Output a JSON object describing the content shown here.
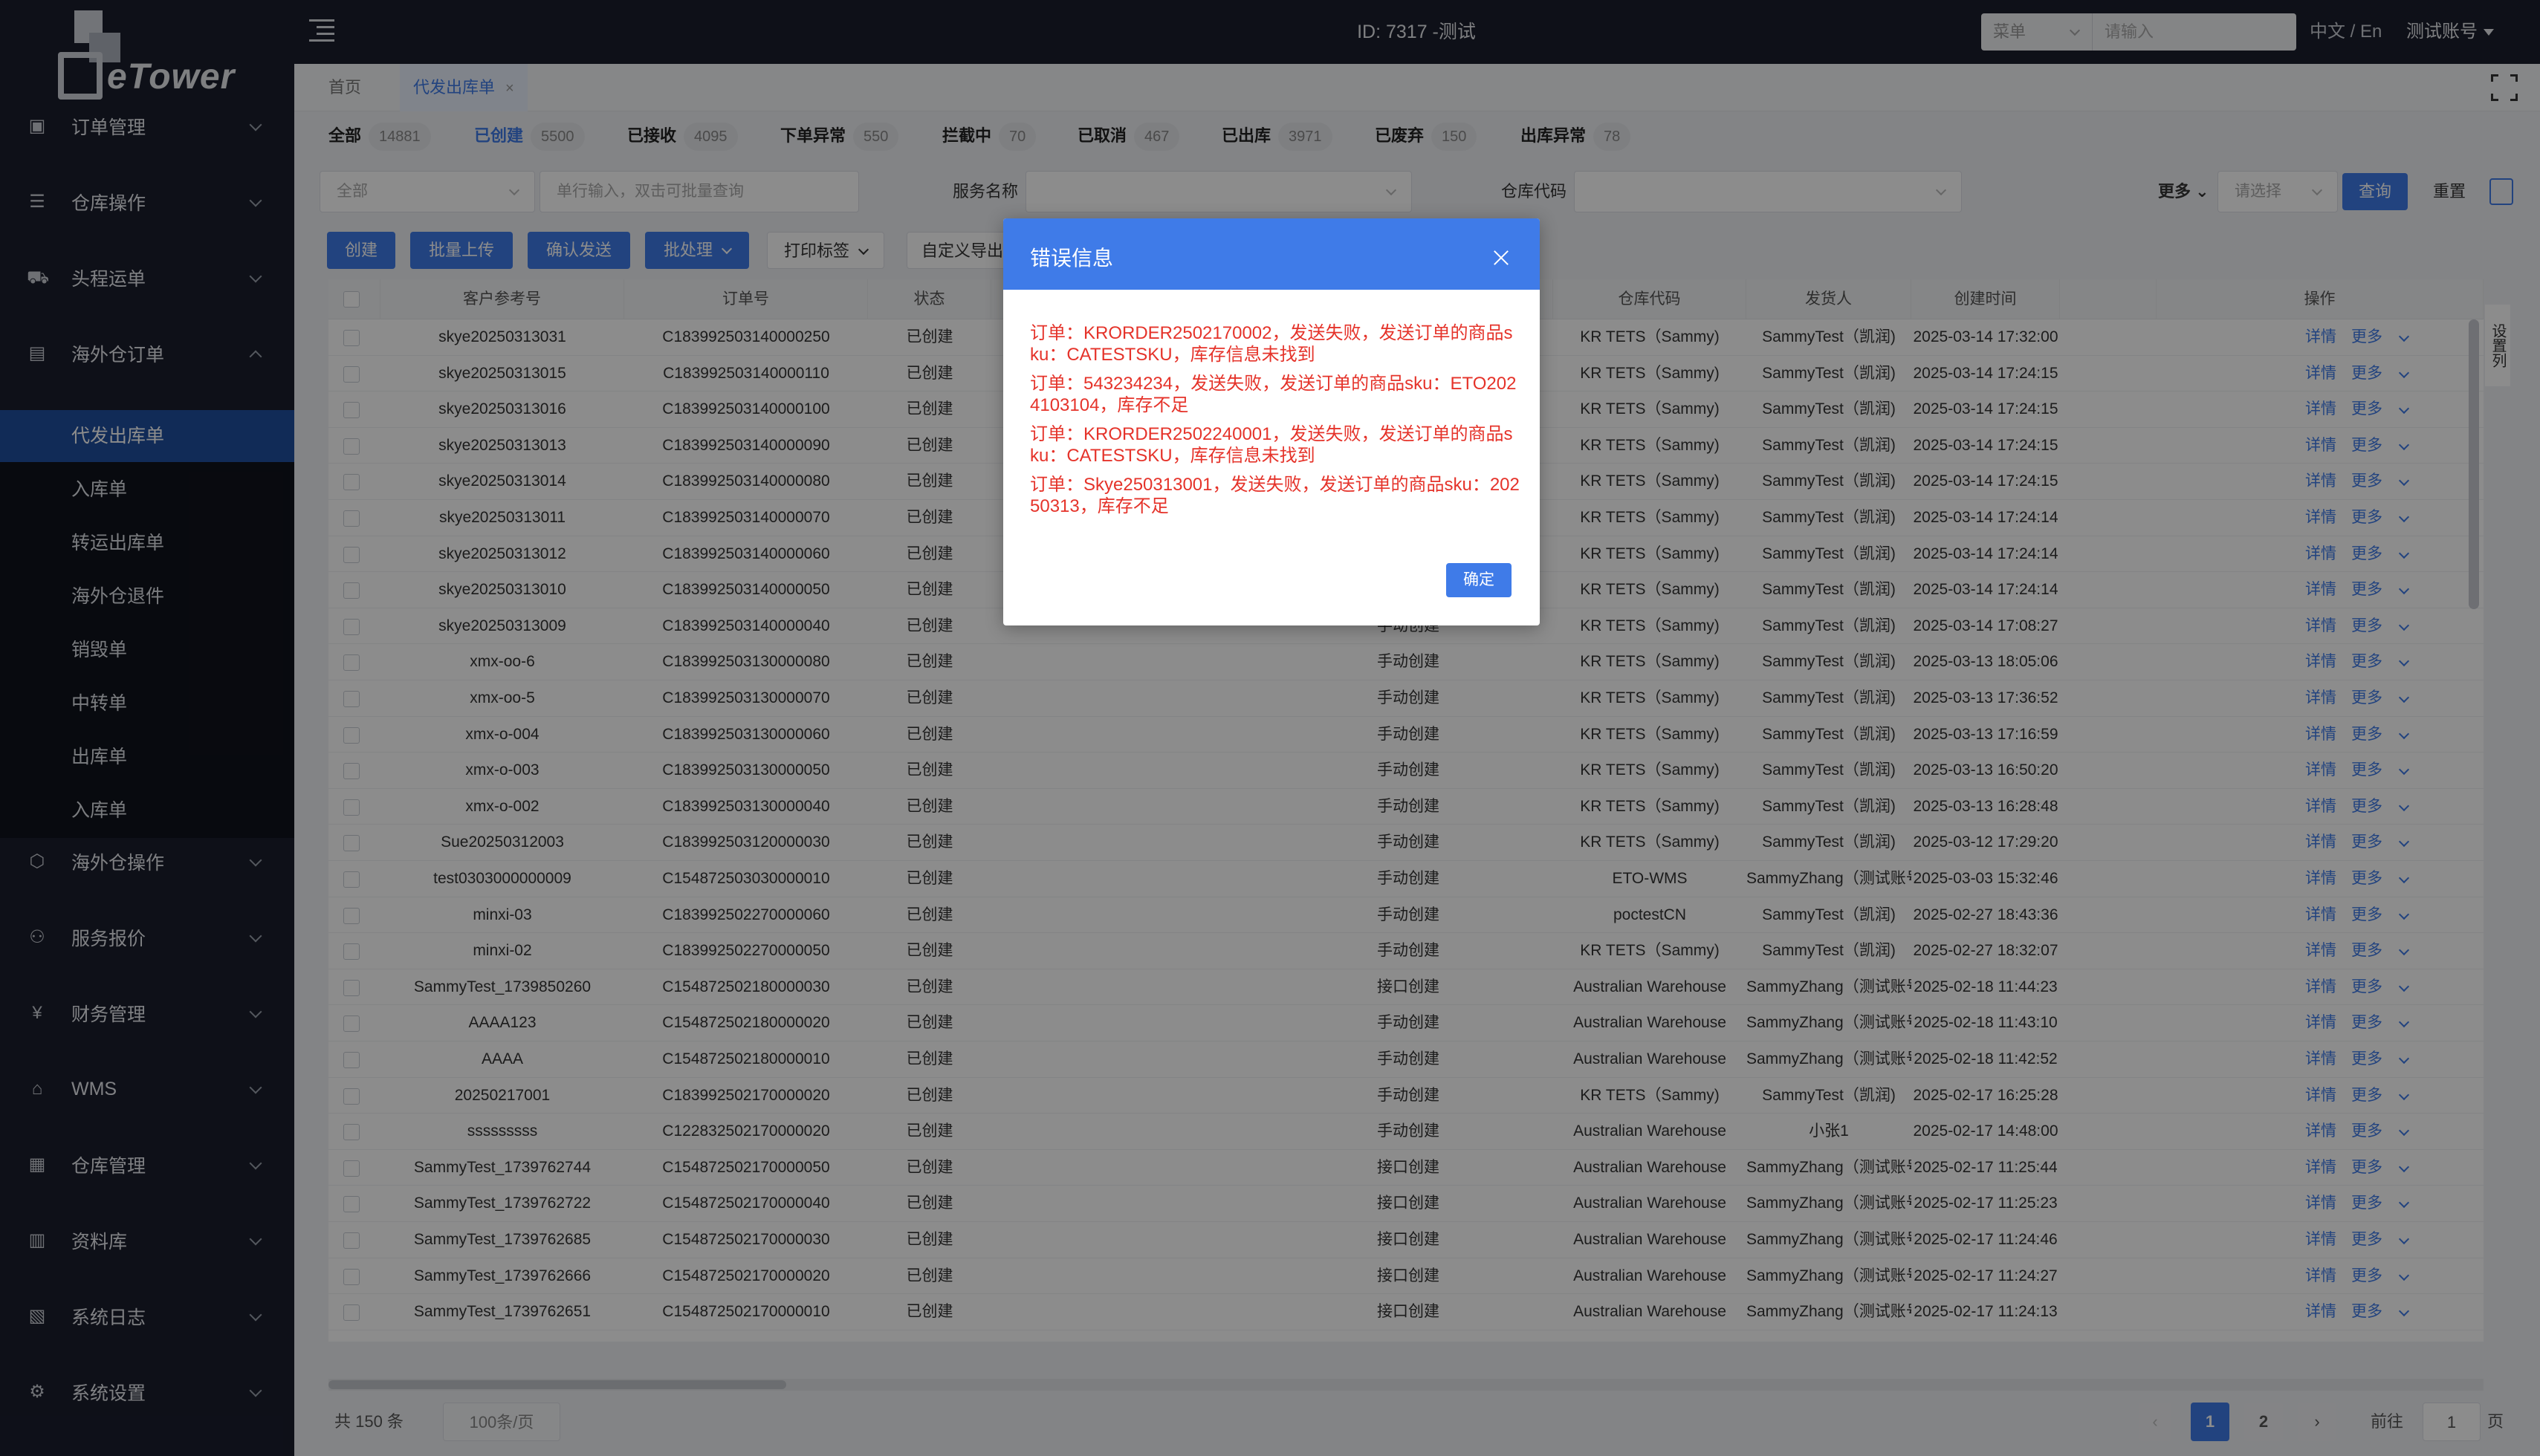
{
  "app": {
    "logo_text": "eTower",
    "top_title": "ID: 7317 -测试",
    "search_select": "菜单",
    "search_placeholder": "请输入",
    "lang": "中文 / En",
    "account": "测试账号"
  },
  "sidebar": {
    "groups": [
      {
        "label": "订单管理",
        "icon": "order-icon",
        "expanded": false
      },
      {
        "label": "仓库操作",
        "icon": "warehouse-op-icon",
        "expanded": false
      },
      {
        "label": "头程运单",
        "icon": "shipping-icon",
        "expanded": false
      },
      {
        "label": "海外仓订单",
        "icon": "document-icon",
        "expanded": true
      },
      {
        "label": "海外仓操作",
        "icon": "box-icon",
        "expanded": false
      },
      {
        "label": "服务报价",
        "icon": "share-icon",
        "expanded": false
      },
      {
        "label": "财务管理",
        "icon": "yen-icon",
        "expanded": false
      },
      {
        "label": "WMS",
        "icon": "home-icon",
        "expanded": false
      },
      {
        "label": "仓库管理",
        "icon": "building-icon",
        "expanded": false
      },
      {
        "label": "资料库",
        "icon": "grid-icon",
        "expanded": false
      },
      {
        "label": "系统日志",
        "icon": "log-icon",
        "expanded": false
      },
      {
        "label": "系统设置",
        "icon": "settings-icon",
        "expanded": false
      }
    ],
    "subitems": [
      "代发出库单",
      "入库单",
      "转运出库单",
      "海外仓退件",
      "销毁单",
      "中转单",
      "出库单",
      "入库单"
    ],
    "active_subitem": "代发出库单"
  },
  "tabs": [
    {
      "label": "首页",
      "active": false
    },
    {
      "label": "代发出库单",
      "active": true,
      "close": "×"
    }
  ],
  "status_tabs": [
    {
      "label": "全部",
      "count": "14881"
    },
    {
      "label": "已创建",
      "count": "5500",
      "active": true
    },
    {
      "label": "已接收",
      "count": "4095"
    },
    {
      "label": "下单异常",
      "count": "550"
    },
    {
      "label": "拦截中",
      "count": "70"
    },
    {
      "label": "已取消",
      "count": "467"
    },
    {
      "label": "已出库",
      "count": "3971"
    },
    {
      "label": "已废弃",
      "count": "150"
    },
    {
      "label": "出库异常",
      "count": "78"
    }
  ],
  "filters": {
    "scope": "全部",
    "query_placeholder": "单行输入，双击可批量查询",
    "service_label": "服务名称",
    "warehouse_label": "仓库代码",
    "more": "更多",
    "more_placeholder": "请选择",
    "search_btn": "查询",
    "reset_btn": "重置"
  },
  "actions": [
    {
      "label": "创建",
      "style": "primary"
    },
    {
      "label": "批量上传",
      "style": "primary"
    },
    {
      "label": "确认发送",
      "style": "primary"
    },
    {
      "label": "批处理",
      "style": "primary",
      "dropdown": true
    },
    {
      "label": "打印标签",
      "style": "plain",
      "dropdown": true
    },
    {
      "label": "自定义导出",
      "style": "plain"
    }
  ],
  "table": {
    "columns": [
      "客户参考号",
      "订单号",
      "状态",
      "",
      "",
      "仓库代码",
      "发货人",
      "创建时间",
      "",
      "操作"
    ],
    "op_detail": "详情",
    "op_more": "更多",
    "rows": [
      [
        "skye20250313031",
        "C183992503140000250",
        "已创建",
        "",
        "KR TETS（Sammy)",
        "SammyTest（凯润)",
        "2025-03-14 17:32:00"
      ],
      [
        "skye20250313015",
        "C183992503140000110",
        "已创建",
        "",
        "KR TETS（Sammy)",
        "SammyTest（凯润)",
        "2025-03-14 17:24:15"
      ],
      [
        "skye20250313016",
        "C183992503140000100",
        "已创建",
        "",
        "KR TETS（Sammy)",
        "SammyTest（凯润)",
        "2025-03-14 17:24:15"
      ],
      [
        "skye20250313013",
        "C183992503140000090",
        "已创建",
        "",
        "KR TETS（Sammy)",
        "SammyTest（凯润)",
        "2025-03-14 17:24:15"
      ],
      [
        "skye20250313014",
        "C183992503140000080",
        "已创建",
        "",
        "KR TETS（Sammy)",
        "SammyTest（凯润)",
        "2025-03-14 17:24:15"
      ],
      [
        "skye20250313011",
        "C183992503140000070",
        "已创建",
        "",
        "KR TETS（Sammy)",
        "SammyTest（凯润)",
        "2025-03-14 17:24:14"
      ],
      [
        "skye20250313012",
        "C183992503140000060",
        "已创建",
        "",
        "KR TETS（Sammy)",
        "SammyTest（凯润)",
        "2025-03-14 17:24:14"
      ],
      [
        "skye20250313010",
        "C183992503140000050",
        "已创建",
        "",
        "KR TETS（Sammy)",
        "SammyTest（凯润)",
        "2025-03-14 17:24:14"
      ],
      [
        "skye20250313009",
        "C183992503140000040",
        "已创建",
        "手动创建",
        "KR TETS（Sammy)",
        "SammyTest（凯润)",
        "2025-03-14 17:08:27"
      ],
      [
        "xmx-oo-6",
        "C183992503130000080",
        "已创建",
        "手动创建",
        "KR TETS（Sammy)",
        "SammyTest（凯润)",
        "2025-03-13 18:05:06"
      ],
      [
        "xmx-oo-5",
        "C183992503130000070",
        "已创建",
        "手动创建",
        "KR TETS（Sammy)",
        "SammyTest（凯润)",
        "2025-03-13 17:36:52"
      ],
      [
        "xmx-o-004",
        "C183992503130000060",
        "已创建",
        "手动创建",
        "KR TETS（Sammy)",
        "SammyTest（凯润)",
        "2025-03-13 17:16:59"
      ],
      [
        "xmx-o-003",
        "C183992503130000050",
        "已创建",
        "手动创建",
        "KR TETS（Sammy)",
        "SammyTest（凯润)",
        "2025-03-13 16:50:20"
      ],
      [
        "xmx-o-002",
        "C183992503130000040",
        "已创建",
        "手动创建",
        "KR TETS（Sammy)",
        "SammyTest（凯润)",
        "2025-03-13 16:28:48"
      ],
      [
        "Sue20250312003",
        "C183992503120000030",
        "已创建",
        "手动创建",
        "KR TETS（Sammy)",
        "SammyTest（凯润)",
        "2025-03-12 17:29:20"
      ],
      [
        "test0303000000009",
        "C154872503030000010",
        "已创建",
        "手动创建",
        "ETO-WMS",
        "SammyZhang（测试账号)",
        "2025-03-03 15:32:46"
      ],
      [
        "minxi-03",
        "C183992502270000060",
        "已创建",
        "手动创建",
        "poctestCN",
        "SammyTest（凯润)",
        "2025-02-27 18:43:36"
      ],
      [
        "minxi-02",
        "C183992502270000050",
        "已创建",
        "手动创建",
        "KR TETS（Sammy)",
        "SammyTest（凯润)",
        "2025-02-27 18:32:07"
      ],
      [
        "SammyTest_1739850260",
        "C154872502180000030",
        "已创建",
        "接口创建",
        "Australian Warehouse",
        "SammyZhang（测试账号)",
        "2025-02-18 11:44:23"
      ],
      [
        "AAAA123",
        "C154872502180000020",
        "已创建",
        "手动创建",
        "Australian Warehouse",
        "SammyZhang（测试账号)",
        "2025-02-18 11:43:10"
      ],
      [
        "AAAA",
        "C154872502180000010",
        "已创建",
        "手动创建",
        "Australian Warehouse",
        "SammyZhang（测试账号)",
        "2025-02-18 11:42:52"
      ],
      [
        "20250217001",
        "C183992502170000020",
        "已创建",
        "手动创建",
        "KR TETS（Sammy)",
        "SammyTest（凯润)",
        "2025-02-17 16:25:28"
      ],
      [
        "sssssssss",
        "C122832502170000020",
        "已创建",
        "手动创建",
        "Australian Warehouse",
        "小张1",
        "2025-02-17 14:48:00"
      ],
      [
        "SammyTest_1739762744",
        "C154872502170000050",
        "已创建",
        "接口创建",
        "Australian Warehouse",
        "SammyZhang（测试账号)",
        "2025-02-17 11:25:44"
      ],
      [
        "SammyTest_1739762722",
        "C154872502170000040",
        "已创建",
        "接口创建",
        "Australian Warehouse",
        "SammyZhang（测试账号)",
        "2025-02-17 11:25:23"
      ],
      [
        "SammyTest_1739762685",
        "C154872502170000030",
        "已创建",
        "接口创建",
        "Australian Warehouse",
        "SammyZhang（测试账号)",
        "2025-02-17 11:24:46"
      ],
      [
        "SammyTest_1739762666",
        "C154872502170000020",
        "已创建",
        "接口创建",
        "Australian Warehouse",
        "SammyZhang（测试账号)",
        "2025-02-17 11:24:27"
      ],
      [
        "SammyTest_1739762651",
        "C154872502170000010",
        "已创建",
        "接口创建",
        "Australian Warehouse",
        "SammyZhang（测试账号)",
        "2025-02-17 11:24:13"
      ]
    ]
  },
  "column_settings": "设置列",
  "pager": {
    "total": "共 150 条",
    "page_size": "100条/页",
    "pages": [
      "1",
      "2"
    ],
    "current": "1",
    "goto_prefix": "前往",
    "goto_value": "1",
    "goto_suffix": "页"
  },
  "dialog": {
    "title": "错误信息",
    "messages": [
      "订单：KRORDER2502170002，发送失败，发送订单的商品sku：CATESTSKU，库存信息未找到",
      "订单：543234234，发送失败，发送订单的商品sku：ETO2024103104，库存不足",
      "订单：KRORDER2502240001，发送失败，发送订单的商品sku：CATESTSKU，库存信息未找到",
      "订单：Skye250313001，发送失败，发送订单的商品sku：20250313，库存不足"
    ],
    "ok": "确定"
  },
  "colors": {
    "accent": "#3f7be8",
    "sidebar_bg": "#1a1e2d",
    "sub_active": "#1f4f9e",
    "error": "#e5332a"
  }
}
